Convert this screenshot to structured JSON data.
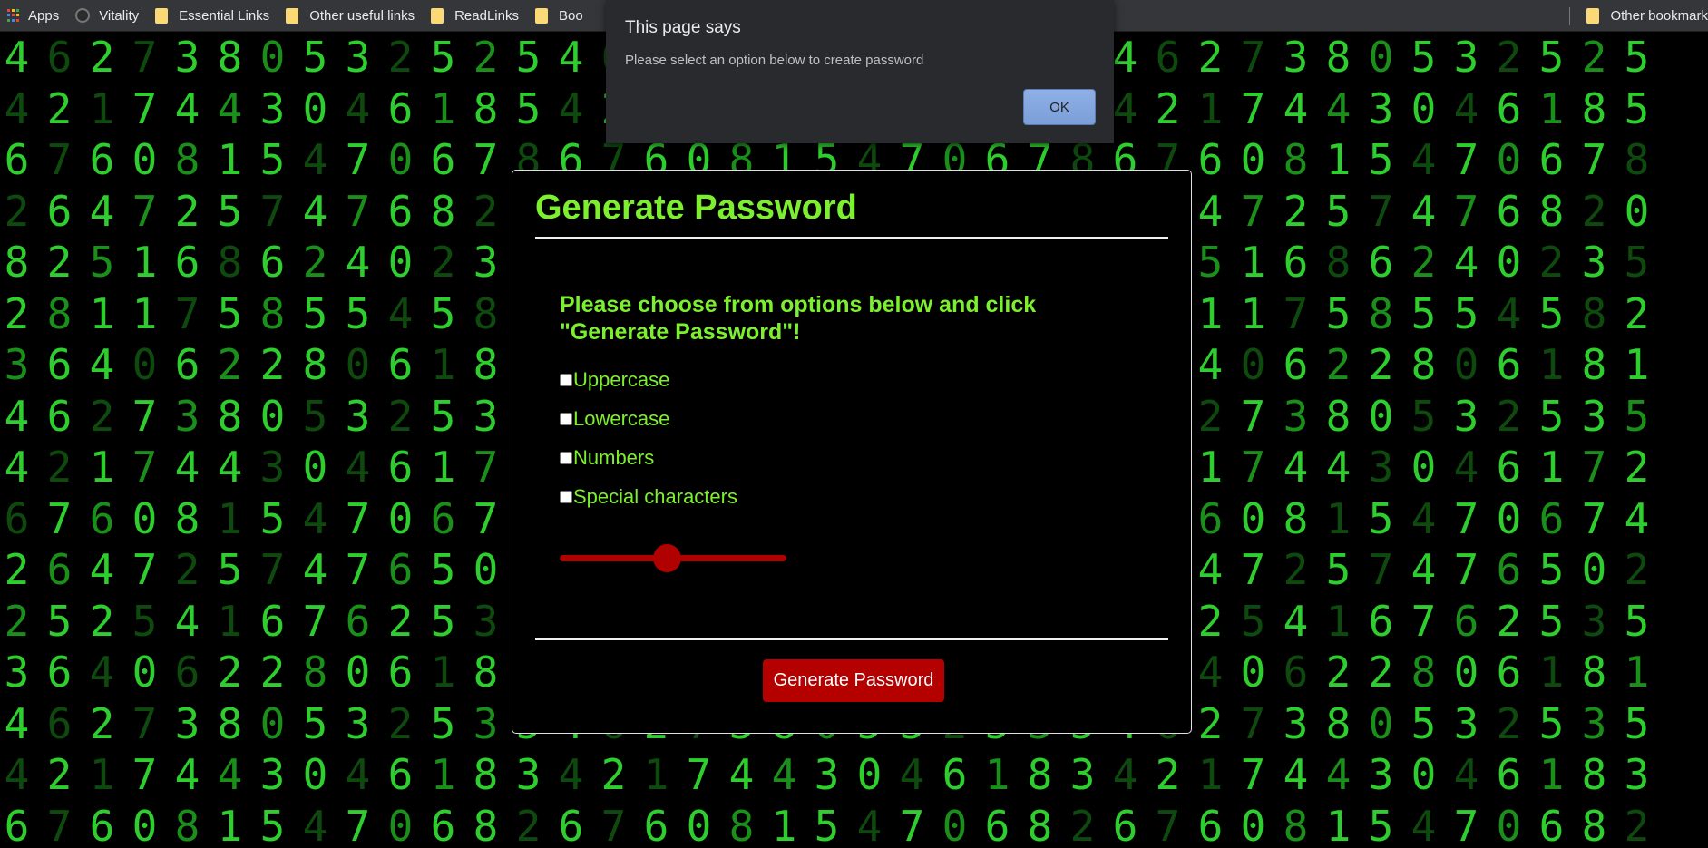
{
  "bookmarks": {
    "apps_label": "Apps",
    "items": [
      "Vitality",
      "Essential Links",
      "Other useful links",
      "ReadLinks",
      "Boo"
    ],
    "other_label": "Other bookmark"
  },
  "alert": {
    "title": "This page says",
    "message": "Please select an option below to create password",
    "ok_label": "OK"
  },
  "card": {
    "title": "Generate Password",
    "prompt": "Please choose from options below and click \"Generate Password\"!",
    "options": [
      "Uppercase",
      "Lowercase",
      "Numbers",
      "Special characters"
    ],
    "slider_value_fraction": 0.47,
    "button_label": "Generate Password"
  },
  "colors": {
    "accent_green": "#7cf02e",
    "button_red": "#b50000",
    "matrix_green": "#2dce2d"
  },
  "matrix_rows": [
    "4627380532525",
    "4217443046185",
    "6760815470678",
    "2647257476820",
    "8251686240235",
    "2811758554582",
    "3640622806181",
    "4627380532535",
    "4217443046172",
    "6760815470674",
    "2647257476502",
    "2525416762535",
    "3640622806181",
    "4627380532535",
    "4217443046183",
    "6760815470682"
  ]
}
